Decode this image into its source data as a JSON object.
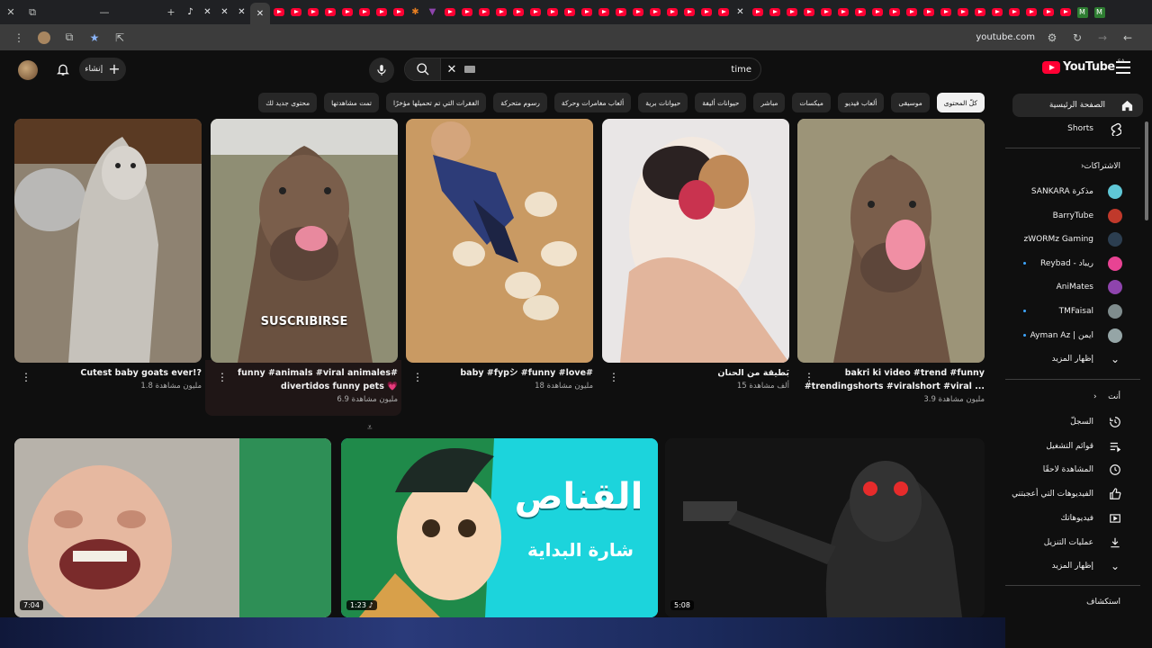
{
  "browser": {
    "url": "youtube.com"
  },
  "header": {
    "create_label": "إنشاء",
    "search_value": "time",
    "logo_text": "YouTube",
    "country_code": "SA"
  },
  "chips": [
    "كلّ المحتوى",
    "موسيقى",
    "ألعاب فيديو",
    "ميكسات",
    "مباشر",
    "حيوانات أليفة",
    "حيوانات برية",
    "ألعاب مغامرات وحركة",
    "رسوم متحركة",
    "الفقرات التي تم تحميلها مؤخرًا",
    "تمت مشاهدتها",
    "محتوى جديد لك"
  ],
  "sidebar": {
    "home": "الصفحة الرئيسية",
    "shorts": "Shorts",
    "subscriptions_title": "الاشتراكات",
    "subscriptions": [
      {
        "name": "SANKARA مذكرة",
        "color": "#5fc7d6"
      },
      {
        "name": "BarryTube",
        "color": "#c0392b"
      },
      {
        "name": "zWORMz Gaming",
        "color": "#2c3e50"
      },
      {
        "name": "Reybad - ريباد",
        "color": "#e84393"
      },
      {
        "name": "AniMates",
        "color": "#8e44ad"
      },
      {
        "name": "TMFaisal",
        "color": "#7f8c8d"
      },
      {
        "name": "Ayman Az | ايمن",
        "color": "#95a5a6"
      }
    ],
    "show_more": "إظهار المزيد",
    "you_title": "أنت",
    "you_items": [
      {
        "label": "السجلّ",
        "icon": "history-icon"
      },
      {
        "label": "قوائم التشغيل",
        "icon": "playlist-icon"
      },
      {
        "label": "المشاهدة لاحقًا",
        "icon": "clock-icon"
      },
      {
        "label": "الفيديوهات التي أعجبتني",
        "icon": "thumbs-up-icon"
      },
      {
        "label": "فيديوهاتك",
        "icon": "play-square-icon"
      },
      {
        "label": "عمليات التنزيل",
        "icon": "download-icon"
      }
    ],
    "show_more_2": "إظهار المزيد",
    "explore_title": "استكشاف"
  },
  "shorts": [
    {
      "title_lines": [
        "bakri ki video #trend #funny",
        "#trendingshorts #viralshort #viral ..."
      ],
      "views": "3.9 مليون مشاهدة"
    },
    {
      "title_lines": [
        "بَطيقة من الحنان"
      ],
      "views": "15 ألف مشاهدة"
    },
    {
      "title_lines": [
        "baby #fypシ #funny #love#"
      ],
      "views": "18 مليون مشاهدة"
    },
    {
      "title_lines": [
        "funny #animals #viral animales#",
        "divertidos funny pets 💗"
      ],
      "views": "6.9 مليون مشاهدة"
    },
    {
      "title_lines": [
        "Cutest baby goats ever!?"
      ],
      "views": "1.8 مليون مشاهدة"
    }
  ],
  "short_overlay_text": "SUSCRIBIRSE",
  "videos": [
    {
      "duration": "5:08"
    },
    {
      "duration": "1:23",
      "title_ar": "القناص",
      "subtitle_ar": "شارة البداية"
    },
    {
      "duration": "7:04"
    }
  ]
}
